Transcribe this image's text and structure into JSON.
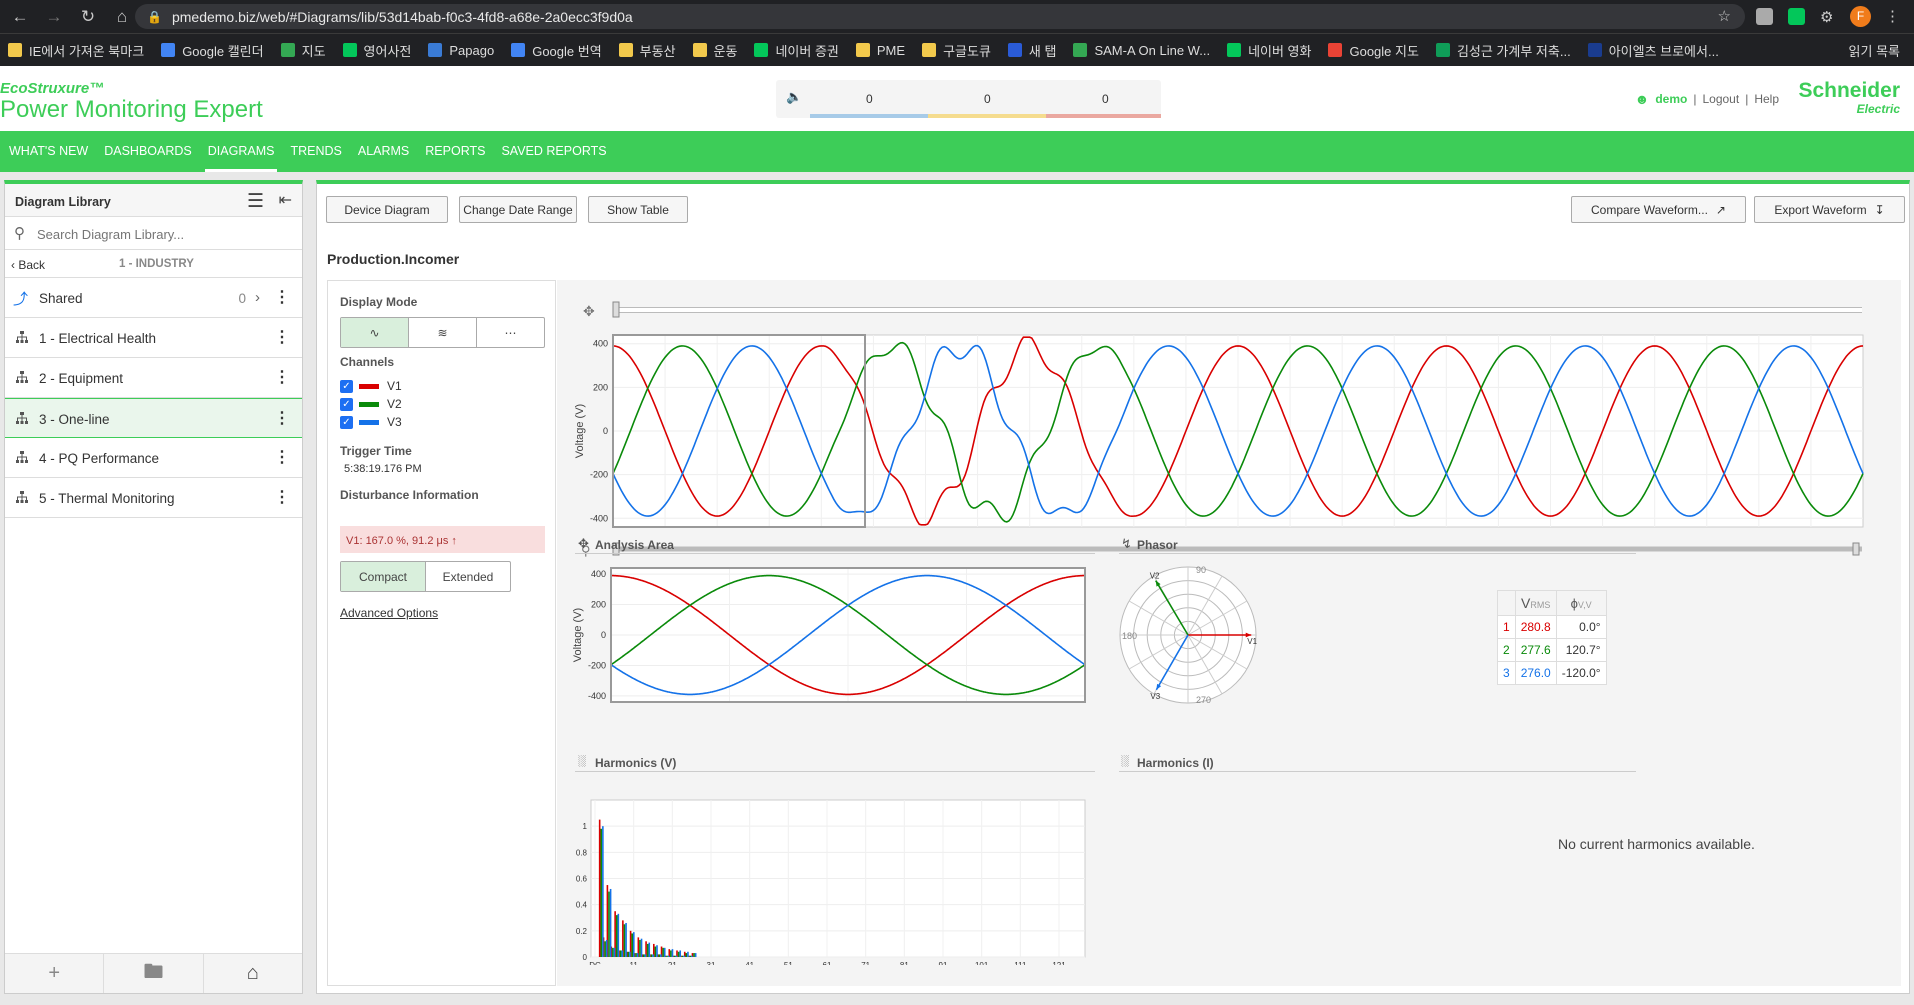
{
  "browser": {
    "url": "pmedemo.biz/web/#Diagrams/lib/53d14bab-f0c3-4fd8-a68e-2a0ecc3f9d0a",
    "bookmarks": [
      "IE에서 가져온 북마크",
      "Google 캘린더",
      "지도",
      "영어사전",
      "Papago",
      "Google 번역",
      "부동산",
      "운동",
      "네이버 증권",
      "PME",
      "구글도큐",
      "새 탭",
      "SAM-A On Line W...",
      "네이버 영화",
      "Google 지도",
      "김성근 가계부 저축...",
      "아이엘츠 브로에서..."
    ],
    "reading_list": "읽기 목록",
    "profile_initial": "F"
  },
  "header": {
    "logo_top": "EcoStruxure™",
    "logo_main": "Power Monitoring Expert",
    "counters": [
      "0",
      "0",
      "0"
    ],
    "user": "demo",
    "logout": "Logout",
    "help": "Help",
    "brand": "Schneider",
    "brand_sub": "Electric"
  },
  "nav": [
    "WHAT'S NEW",
    "DASHBOARDS",
    "DIAGRAMS",
    "TRENDS",
    "ALARMS",
    "REPORTS",
    "SAVED REPORTS"
  ],
  "library": {
    "title": "Diagram Library",
    "search_placeholder": "Search Diagram Library...",
    "back": "Back",
    "path": "1 - INDUSTRY",
    "shared": {
      "label": "Shared",
      "count": "0"
    },
    "items": [
      "1 - Electrical Health",
      "2 - Equipment",
      "3 - One-line",
      "4 - PQ Performance",
      "5 - Thermal Monitoring"
    ]
  },
  "toolbar": {
    "device_diagram": "Device Diagram",
    "change_date": "Change Date Range",
    "show_table": "Show Table",
    "compare": "Compare Waveform...",
    "export": "Export Waveform"
  },
  "device_title": "Production.Incomer",
  "options": {
    "display_mode": "Display Mode",
    "channels_label": "Channels",
    "channels": [
      {
        "name": "V1",
        "color": "#d90000"
      },
      {
        "name": "V2",
        "color": "#0a8a0a"
      },
      {
        "name": "V3",
        "color": "#1472e8"
      }
    ],
    "trigger_label": "Trigger Time",
    "trigger_time": "5:38:19.176 PM",
    "disturbance_label": "Disturbance Information",
    "disturbance": "V1: 167.0 %, 91.2 μs ↑",
    "compact": "Compact",
    "extended": "Extended",
    "advanced": "Advanced Options"
  },
  "sections": {
    "analysis": "Analysis Area",
    "phasor": "Phasor",
    "harmonics_v": "Harmonics (V)",
    "harmonics_i": "Harmonics (I)",
    "no_harmonics": "No current harmonics available."
  },
  "phasor_table": {
    "h_v": "V",
    "h_v_sub": "RMS",
    "h_phi": "ϕ",
    "h_phi_sub": "V,V",
    "rows": [
      {
        "n": "1",
        "v": "280.8",
        "a": "0.0°"
      },
      {
        "n": "2",
        "v": "277.6",
        "a": "120.7°"
      },
      {
        "n": "3",
        "v": "276.0",
        "a": "-120.0°"
      }
    ]
  },
  "chart_data": [
    {
      "type": "line",
      "name": "main waveform",
      "ylabel": "Voltage (V)",
      "yticks": [
        400,
        200,
        0,
        -200,
        -400
      ],
      "ylim": [
        -440,
        440
      ],
      "cycles": 6,
      "disturbance_cycles": [
        1.0,
        2.5
      ],
      "series": [
        {
          "name": "V1",
          "amplitude": 390,
          "phase_deg": 90
        },
        {
          "name": "V2",
          "amplitude": 390,
          "phase_deg": -30
        },
        {
          "name": "V3",
          "amplitude": 390,
          "phase_deg": 210
        }
      ]
    },
    {
      "type": "line",
      "name": "analysis area",
      "ylabel": "Voltage (V)",
      "yticks": [
        400,
        200,
        0,
        -200,
        -400
      ],
      "ylim": [
        -440,
        440
      ],
      "cycles": 1,
      "series": [
        {
          "name": "V1",
          "amplitude": 390,
          "phase_deg": 90
        },
        {
          "name": "V2",
          "amplitude": 390,
          "phase_deg": -30
        },
        {
          "name": "V3",
          "amplitude": 390,
          "phase_deg": 210
        }
      ]
    },
    {
      "type": "bar",
      "name": "harmonics voltage",
      "ylim": [
        0,
        1.2
      ],
      "yticks": [
        1,
        0.8,
        0.6,
        0.4,
        0.2,
        0
      ],
      "xticks": [
        "DC",
        "11",
        "21",
        "31",
        "41",
        "51",
        "61",
        "71",
        "81",
        "91",
        "101",
        "111",
        "121"
      ],
      "series": [
        {
          "name": "V1",
          "values": [
            0,
            1.05,
            0.15,
            0.55,
            0.08,
            0.35,
            0.05,
            0.28,
            0.04,
            0.2,
            0.03,
            0.15,
            0.02,
            0.12,
            0.02,
            0.1,
            0.02,
            0.08,
            0.01,
            0.06,
            0.01,
            0.05,
            0.01,
            0.04,
            0.01,
            0.03
          ]
        },
        {
          "name": "V2",
          "values": [
            0,
            0.98,
            0.12,
            0.5,
            0.07,
            0.32,
            0.05,
            0.25,
            0.04,
            0.18,
            0.03,
            0.13,
            0.02,
            0.1,
            0.02,
            0.08,
            0.02,
            0.07,
            0.01,
            0.05,
            0.01,
            0.04,
            0.01,
            0.03,
            0.01,
            0.03
          ]
        },
        {
          "name": "V3",
          "values": [
            0,
            1.0,
            0.13,
            0.52,
            0.07,
            0.33,
            0.05,
            0.26,
            0.04,
            0.19,
            0.03,
            0.14,
            0.02,
            0.11,
            0.02,
            0.09,
            0.02,
            0.07,
            0.01,
            0.06,
            0.01,
            0.05,
            0.01,
            0.04,
            0.01,
            0.03
          ]
        }
      ]
    },
    {
      "type": "scatter",
      "name": "phasor",
      "angle_labels": [
        "90",
        "180",
        "270"
      ],
      "vectors": [
        {
          "name": "V1",
          "angle_deg": 0,
          "magnitude": 1
        },
        {
          "name": "V2",
          "angle_deg": 120.7,
          "magnitude": 1
        },
        {
          "name": "V3",
          "angle_deg": -120,
          "magnitude": 1
        }
      ]
    }
  ]
}
